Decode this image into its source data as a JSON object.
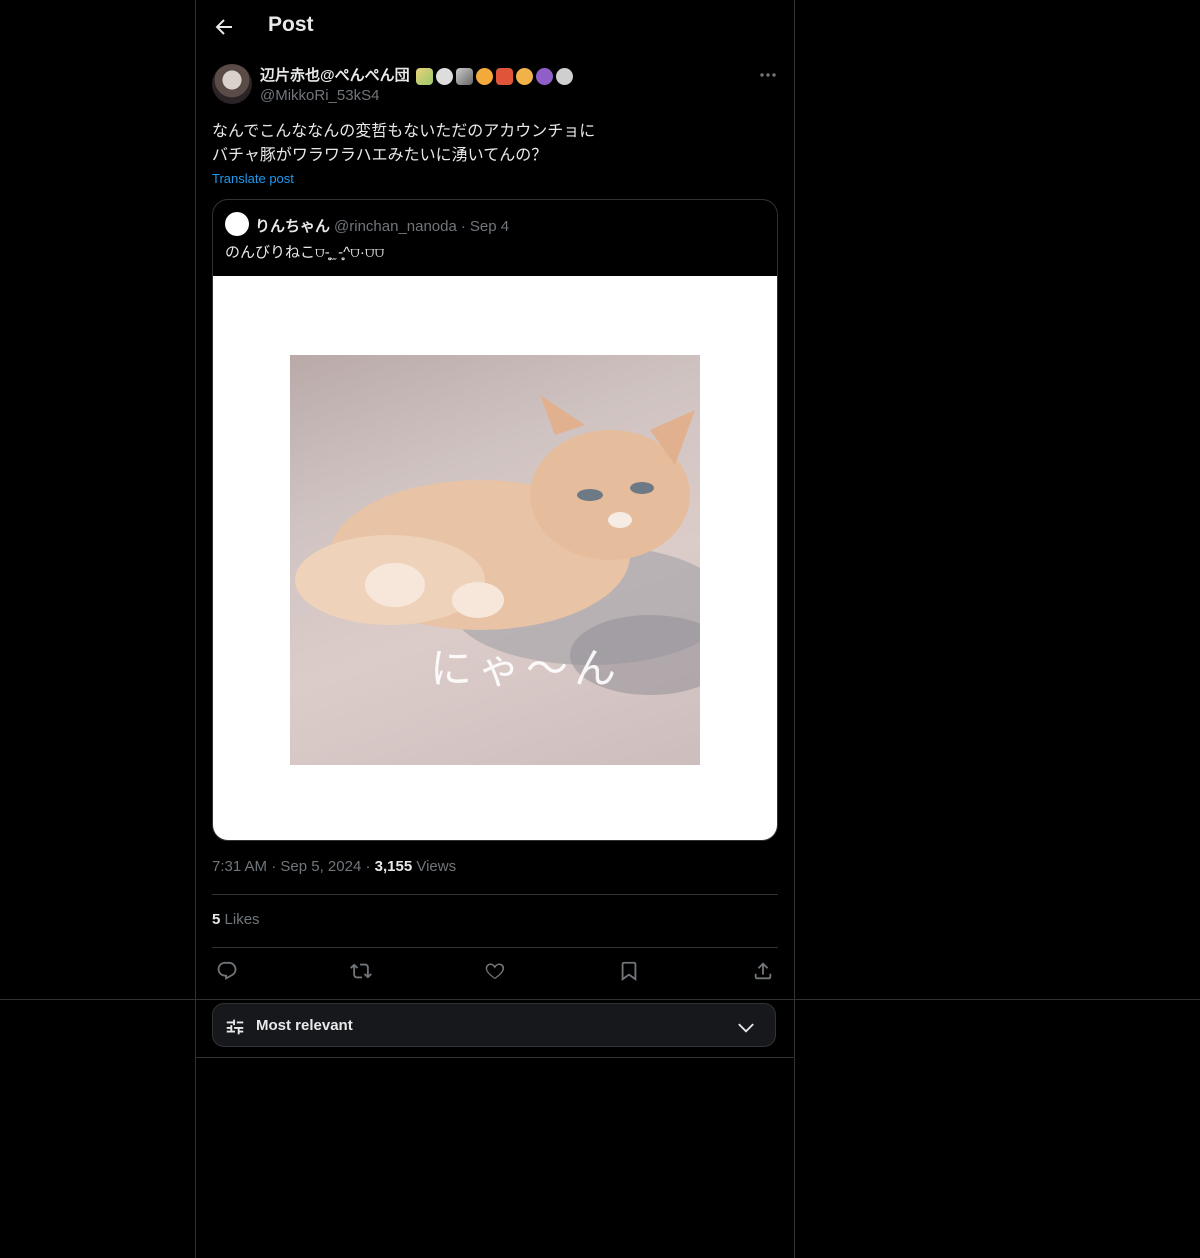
{
  "header": {
    "title": "Post"
  },
  "post": {
    "author_name": "辺片赤也@ぺんぺん団",
    "author_handle": "@MikkoRi_53kS4",
    "text_line1": "なんでこんななんの変哲もないただのアカウンチョに",
    "text_line2": "バチャ豚がワラワラハエみたいに湧いてんの？",
    "translate_label": "Translate post",
    "time": "7:31 AM",
    "date": "Sep 5, 2024",
    "views_count": "3,155",
    "views_label": "Views",
    "likes_count": "5",
    "likes_label": "Likes"
  },
  "quote": {
    "name": "りんちゃん",
    "handle": "@rinchan_nanoda",
    "date": "Sep 4",
    "text": "のんびりねこ⩌-̥̥̥̥ ̫ -̥̥̥̥^⩌·⩌⩌",
    "image_caption": "にゃ〜ん"
  },
  "sort": {
    "label": "Most relevant"
  },
  "icons": {
    "back": "arrow-left-icon",
    "more": "more-icon",
    "reply": "reply-icon",
    "repost": "repost-icon",
    "like": "heart-icon",
    "bookmark": "bookmark-icon",
    "share": "share-icon",
    "sort": "sliders-icon",
    "chevron": "chevron-down-icon"
  },
  "colors": {
    "accent": "#1d9bf0",
    "secondary_text": "#71767b",
    "border": "#2f3336"
  }
}
